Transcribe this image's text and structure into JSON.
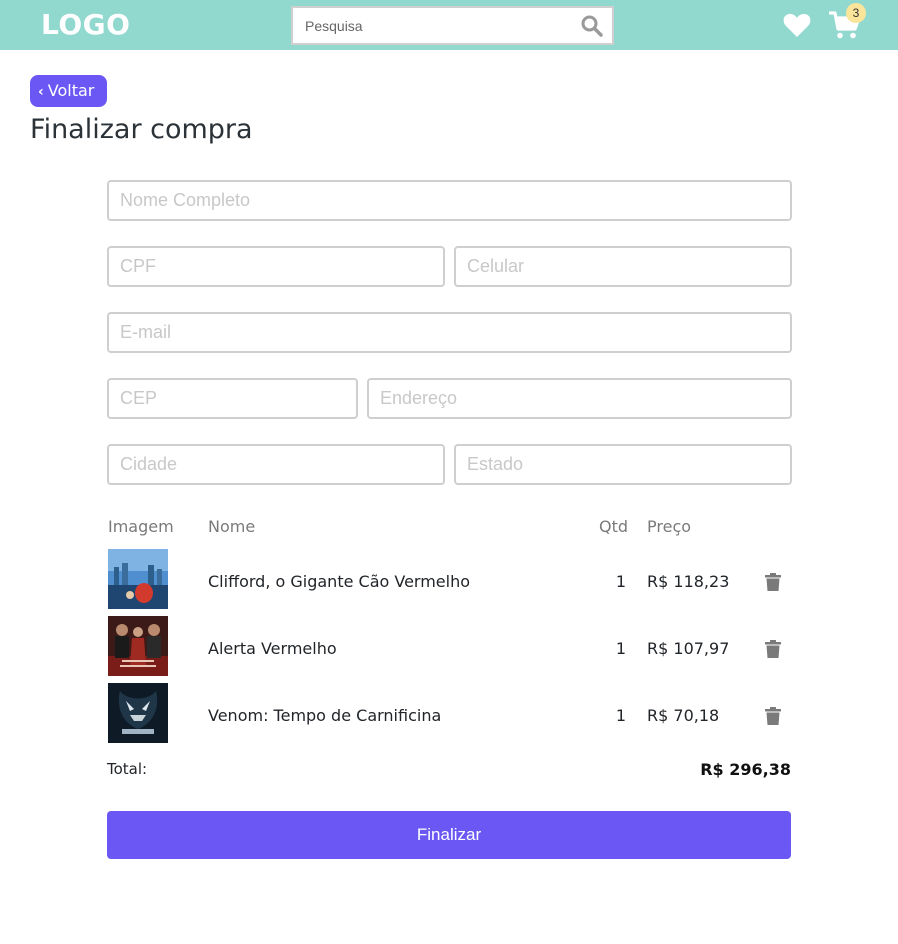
{
  "header": {
    "logo": "LOGO",
    "search_placeholder": "Pesquisa",
    "cart_count": "3",
    "colors": {
      "topbar": "#91d8cf",
      "badge": "#fbe59a"
    },
    "icons": [
      "search-icon",
      "heart-icon",
      "cart-icon"
    ]
  },
  "back_button": {
    "label": "Voltar",
    "icon": "chevron-left-icon"
  },
  "page_title": "Finalizar compra",
  "form": {
    "nome": {
      "placeholder": "Nome Completo",
      "value": ""
    },
    "cpf": {
      "placeholder": "CPF",
      "value": ""
    },
    "celular": {
      "placeholder": "Celular",
      "value": ""
    },
    "email": {
      "placeholder": "E-mail",
      "value": ""
    },
    "cep": {
      "placeholder": "CEP",
      "value": ""
    },
    "endereco": {
      "placeholder": "Endereço",
      "value": ""
    },
    "cidade": {
      "placeholder": "Cidade",
      "value": ""
    },
    "estado": {
      "placeholder": "Estado",
      "value": ""
    }
  },
  "table": {
    "headers": {
      "imagem": "Imagem",
      "nome": "Nome",
      "qtd": "Qtd",
      "preco": "Preço"
    },
    "rows": [
      {
        "name": "Clifford, o Gigante Cão Vermelho",
        "qty": "1",
        "price": "R$ 118,23"
      },
      {
        "name": "Alerta Vermelho",
        "qty": "1",
        "price": "R$ 107,97"
      },
      {
        "name": "Venom: Tempo de Carnificina",
        "qty": "1",
        "price": "R$ 70,18"
      }
    ]
  },
  "total": {
    "label": "Total:",
    "value": "R$ 296,38"
  },
  "finish_button": {
    "label": "Finalizar",
    "color": "#6b57f4"
  }
}
